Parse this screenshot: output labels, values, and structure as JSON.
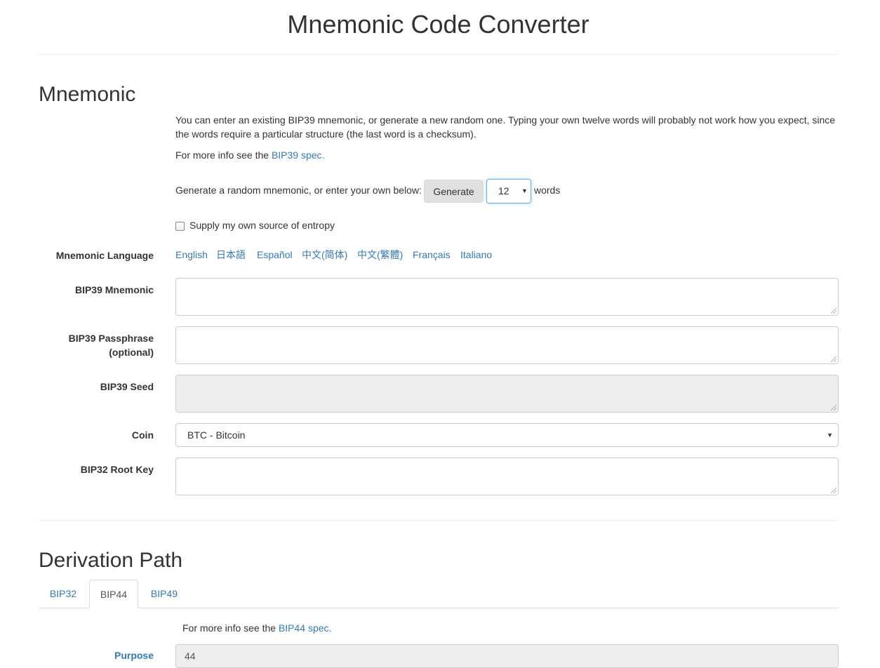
{
  "header": {
    "title": "Mnemonic Code Converter"
  },
  "mnemonic_section": {
    "heading": "Mnemonic",
    "intro": "You can enter an existing BIP39 mnemonic, or generate a new random one. Typing your own twelve words will probably not work how you expect, since the words require a particular structure (the last word is a checksum).",
    "more_info_prefix": "For more info see the ",
    "more_info_link": "BIP39 spec",
    "more_info_suffix": ".",
    "generate_prefix": "Generate a random mnemonic, or enter your own below:",
    "generate_button": "Generate",
    "word_count": "12",
    "words_suffix": "words",
    "entropy_checkbox_label": "Supply my own source of entropy",
    "language_label": "Mnemonic Language",
    "languages": [
      "English",
      "日本語",
      "Español",
      "中文(简体)",
      "中文(繁體)",
      "Français",
      "Italiano"
    ],
    "bip39_mnemonic_label": "BIP39 Mnemonic",
    "bip39_passphrase_label_line1": "BIP39 Passphrase",
    "bip39_passphrase_label_line2": "(optional)",
    "bip39_seed_label": "BIP39 Seed",
    "coin_label": "Coin",
    "coin_value": "BTC - Bitcoin",
    "bip32_root_key_label": "BIP32 Root Key"
  },
  "derivation_section": {
    "heading": "Derivation Path",
    "tabs": [
      {
        "label": "BIP32",
        "active": false
      },
      {
        "label": "BIP44",
        "active": true
      },
      {
        "label": "BIP49",
        "active": false
      }
    ],
    "more_info_prefix": "For more info see the ",
    "more_info_link": "BIP44 spec",
    "more_info_suffix": ".",
    "purpose_label": "Purpose",
    "purpose_value": "44"
  },
  "colors": {
    "link": "#337ab7",
    "text": "#333333",
    "readonly_bg": "#eeeeee",
    "focus_border": "#66afe9"
  }
}
